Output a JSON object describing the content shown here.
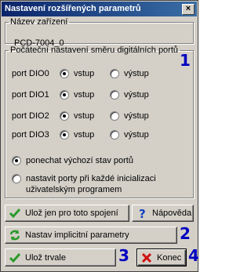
{
  "window": {
    "title": "Nastavení rozšířených parametrů",
    "close_glyph": "×"
  },
  "device": {
    "legend": "Název zařízení",
    "value": "PCD-7004_0"
  },
  "ports": {
    "legend": "Počáteční nastavení směru digitálních portů",
    "rows": [
      {
        "label": "port DIO0",
        "input": "vstup",
        "output": "výstup",
        "selected": "input"
      },
      {
        "label": "port DIO1",
        "input": "vstup",
        "output": "výstup",
        "selected": "input"
      },
      {
        "label": "port DIO2",
        "input": "vstup",
        "output": "výstup",
        "selected": "input"
      },
      {
        "label": "port DIO3",
        "input": "vstup",
        "output": "výstup",
        "selected": "input"
      }
    ],
    "mode_options": [
      {
        "label": "ponechat výchozí stav portů",
        "checked": true
      },
      {
        "label_line1": "nastavit porty při každé inicializaci",
        "label_line2": "uživatelským programem",
        "checked": false
      }
    ]
  },
  "buttons": {
    "save_connection": "Ulož jen pro toto spojení",
    "help": "Nápověda",
    "set_defaults": "Nastav implicitní parametry",
    "save_permanent": "Ulož trvale",
    "close": "Konec"
  },
  "annotations": {
    "n1": "1",
    "n2": "2",
    "n3": "3",
    "n4": "4"
  },
  "colors": {
    "annotation": "#0000c0",
    "check": "#2a9a2a",
    "close_x": "#d01010",
    "help": "#1040c0"
  }
}
